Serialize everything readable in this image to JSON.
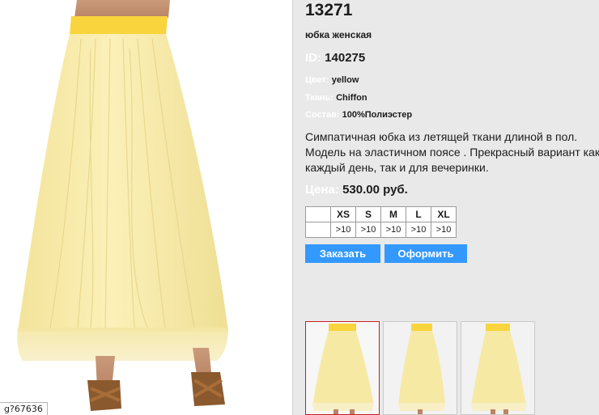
{
  "product": {
    "code": "13271",
    "subtitle": "юбка женская",
    "id_label": "ID:",
    "id_value": "140275",
    "color_label": "Цвет:",
    "color_value": "yellow",
    "fabric_label": "Ткань:",
    "fabric_value": "Chiffon",
    "composition_label": "Состав:",
    "composition_value": "100%Полиэстер",
    "description_lines": [
      "Симпатичная юбка из летящей ткани длиной в пол.",
      "Модель на эластичном поясе . Прекрасный вариант как на",
      "каждый день, так и для вечеринки."
    ],
    "price_label": "Цена:",
    "price_value": "530.00 руб."
  },
  "sizes": {
    "headers": [
      "XS",
      "S",
      "M",
      "L",
      "XL"
    ],
    "stock": [
      ">10",
      ">10",
      ">10",
      ">10",
      ">10"
    ]
  },
  "buttons": {
    "order": "Заказать",
    "checkout": "Оформить"
  },
  "status_url": "g?67636",
  "colors": {
    "skirt": "#f6e9a4",
    "waistband": "#f9d43c",
    "button": "#3399ff",
    "active_thumb_border": "#c8201f"
  }
}
